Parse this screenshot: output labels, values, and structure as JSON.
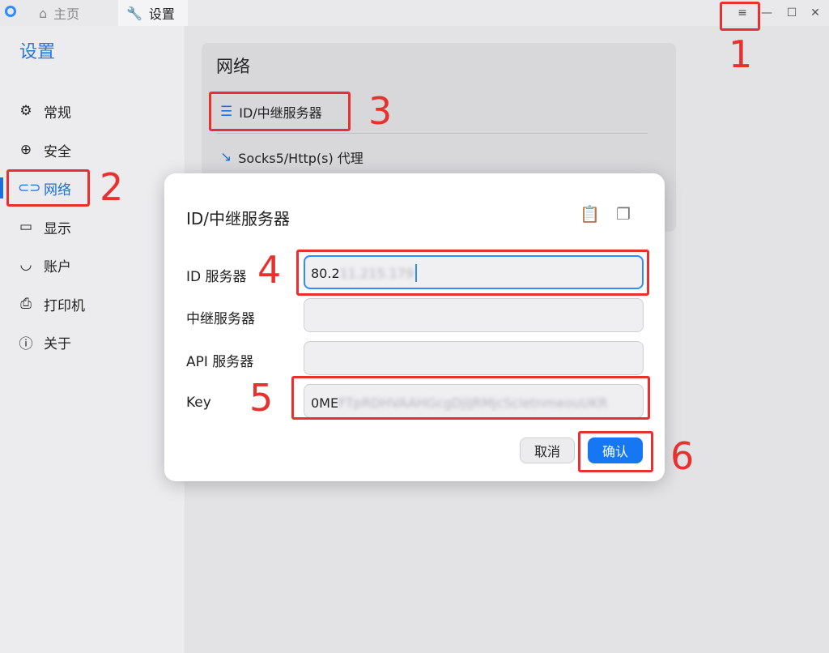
{
  "titlebar": {
    "tabs": [
      {
        "label": "主页",
        "icon": "home-icon"
      },
      {
        "label": "设置",
        "icon": "wrench-icon"
      }
    ],
    "menu_icon": "menu-icon",
    "minimize_icon": "minimize-icon",
    "maximize_icon": "maximize-icon",
    "close_icon": "close-icon"
  },
  "sidebar": {
    "title": "设置",
    "items": [
      {
        "label": "常规",
        "icon": "gear-icon"
      },
      {
        "label": "安全",
        "icon": "lock-icon"
      },
      {
        "label": "网络",
        "icon": "link-icon",
        "active": true
      },
      {
        "label": "显示",
        "icon": "monitor-icon"
      },
      {
        "label": "账户",
        "icon": "user-icon"
      },
      {
        "label": "打印机",
        "icon": "printer-icon"
      },
      {
        "label": "关于",
        "icon": "info-icon"
      }
    ]
  },
  "network_card": {
    "title": "网络",
    "items": [
      {
        "label": "ID/中继服务器",
        "icon": "server-icon"
      },
      {
        "label": "Socks5/Http(s) 代理",
        "icon": "proxy-icon"
      }
    ]
  },
  "dialog": {
    "title": "ID/中继服务器",
    "paste_icon": "clipboard-icon",
    "copy_icon": "copy-icon",
    "fields": {
      "id_server": {
        "label": "ID 服务器",
        "value_visible": "80.2",
        "value_blurred": "11.215.179"
      },
      "relay_server": {
        "label": "中继服务器",
        "value": ""
      },
      "api_server": {
        "label": "API 服务器",
        "value": ""
      },
      "key": {
        "label": "Key",
        "value_visible": "0ME",
        "value_blurred": "FTpRDHVAAHGcgDjlJRMjcScletnmeouUKR"
      }
    },
    "cancel_label": "取消",
    "ok_label": "确认"
  },
  "annotations": [
    "1",
    "2",
    "3",
    "4",
    "5",
    "6"
  ],
  "colors": {
    "accent": "#1d6fd8",
    "annotation": "#e8312f",
    "primary_button": "#1677f2"
  }
}
